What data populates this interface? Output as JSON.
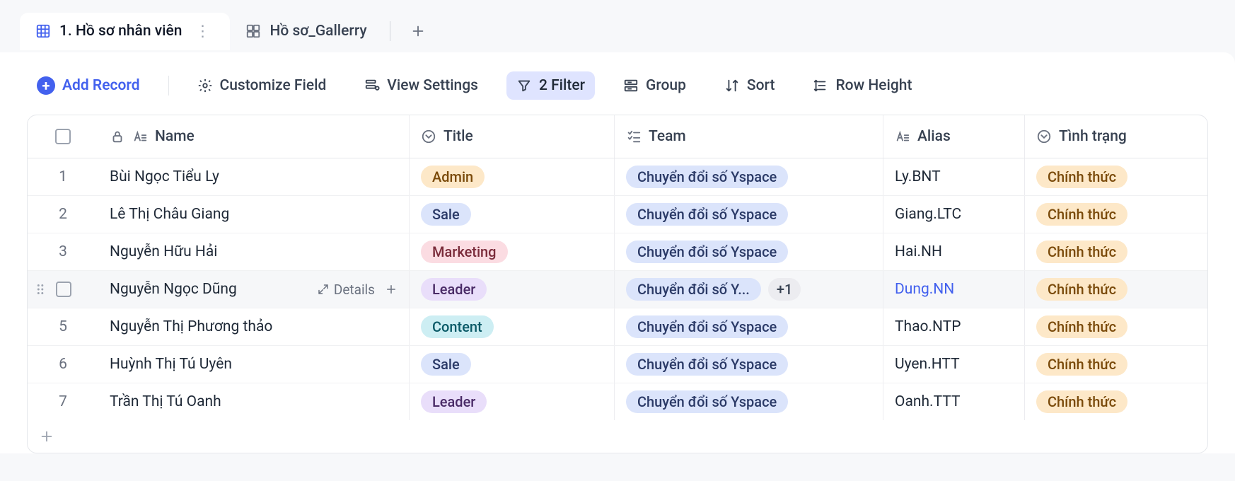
{
  "tabs": {
    "active": {
      "label": "1. Hồ sơ nhân viên"
    },
    "second": {
      "label": "Hồ sơ_Gallerry"
    }
  },
  "toolbar": {
    "add_record": "Add Record",
    "customize_field": "Customize Field",
    "view_settings": "View Settings",
    "filter": "2 Filter",
    "group": "Group",
    "sort": "Sort",
    "row_height": "Row Height"
  },
  "columns": {
    "name": "Name",
    "title": "Title",
    "team": "Team",
    "alias": "Alias",
    "status": "Tình trạng"
  },
  "hoverRow": {
    "details": "Details"
  },
  "rows": [
    {
      "idx": "1",
      "name": "Bùi Ngọc Tiểu Ly",
      "title": "Admin",
      "title_class": "tag-orange",
      "team": "Chuyển đổi số Yspace",
      "team_extra": "",
      "alias": "Ly.BNT",
      "alias_link": false,
      "status": "Chính thức",
      "hovered": false
    },
    {
      "idx": "2",
      "name": "Lê Thị Châu Giang",
      "title": "Sale",
      "title_class": "tag-blue",
      "team": "Chuyển đổi số Yspace",
      "team_extra": "",
      "alias": "Giang.LTC",
      "alias_link": false,
      "status": "Chính thức",
      "hovered": false
    },
    {
      "idx": "3",
      "name": "Nguyễn Hữu Hải",
      "title": "Marketing",
      "title_class": "tag-pink",
      "team": "Chuyển đổi số Yspace",
      "team_extra": "",
      "alias": "Hai.NH",
      "alias_link": false,
      "status": "Chính thức",
      "hovered": false
    },
    {
      "idx": "4",
      "name": "Nguyễn Ngọc Dũng",
      "title": "Leader",
      "title_class": "tag-purple",
      "team": "Chuyển đổi số Y...",
      "team_extra": "+1",
      "alias": "Dung.NN",
      "alias_link": true,
      "status": "Chính thức",
      "hovered": true
    },
    {
      "idx": "5",
      "name": "Nguyễn Thị Phương thảo",
      "title": "Content",
      "title_class": "tag-cyan",
      "team": "Chuyển đổi số Yspace",
      "team_extra": "",
      "alias": "Thao.NTP",
      "alias_link": false,
      "status": "Chính thức",
      "hovered": false
    },
    {
      "idx": "6",
      "name": "Huỳnh Thị Tú Uyên",
      "title": "Sale",
      "title_class": "tag-blue",
      "team": "Chuyển đổi số Yspace",
      "team_extra": "",
      "alias": "Uyen.HTT",
      "alias_link": false,
      "status": "Chính thức",
      "hovered": false
    },
    {
      "idx": "7",
      "name": "Trần Thị Tú Oanh",
      "title": "Leader",
      "title_class": "tag-purple",
      "team": "Chuyển đổi số Yspace",
      "team_extra": "",
      "alias": "Oanh.TTT",
      "alias_link": false,
      "status": "Chính thức",
      "hovered": false
    }
  ]
}
